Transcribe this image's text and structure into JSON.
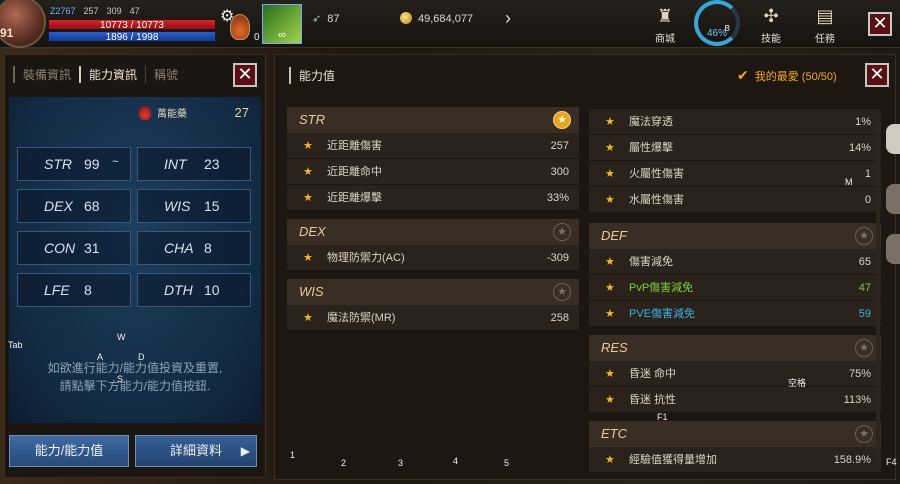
{
  "hud": {
    "level": "91",
    "stat1": "Z2767",
    "stat2": "257",
    "stat3": "309",
    "stat4": "47",
    "hp": "10773 / 10773",
    "mp": "1896 / 1998",
    "potion_count": "0",
    "buff_label": "∞",
    "currency1": "87",
    "gold": "49,684,077",
    "menus": [
      {
        "label": "商城",
        "icon": "bag-icon"
      },
      {
        "label": "46%",
        "key": "B"
      },
      {
        "label": "技能",
        "icon": "skill-icon"
      },
      {
        "label": "任務",
        "icon": "scroll-icon"
      }
    ],
    "close_label": "✕"
  },
  "left": {
    "tabs": [
      "裝備資訊",
      "能力資訊",
      "稱號"
    ],
    "active_tab": 1,
    "elixir_label": "萬能藥",
    "stat_points": "27",
    "stats": [
      {
        "key": "STR",
        "value": "99",
        "extra": "~"
      },
      {
        "key": "INT",
        "value": "23"
      },
      {
        "key": "DEX",
        "value": "68"
      },
      {
        "key": "WIS",
        "value": "15"
      },
      {
        "key": "CON",
        "value": "31"
      },
      {
        "key": "CHA",
        "value": "8"
      },
      {
        "key": "LFE",
        "value": "8"
      },
      {
        "key": "DTH",
        "value": "10"
      }
    ],
    "note_line1": "如欲進行能力/能力值投資及重置,",
    "note_line2": "請點擊下方能力/能力值按鈕.",
    "btn_ability": "能力/能力值",
    "btn_detail": "詳細資料"
  },
  "right": {
    "title": "能力值",
    "favorites": "我的最愛 (50/50)",
    "left_col": [
      {
        "section": "STR",
        "fav": true,
        "rows": [
          {
            "name": "近距離傷害",
            "value": "257"
          },
          {
            "name": "近距離命中",
            "value": "300"
          },
          {
            "name": "近距離爆擊",
            "value": "33%"
          }
        ]
      },
      {
        "section": "DEX",
        "fav": false,
        "rows": [
          {
            "name": "物理防禦力(AC)",
            "value": "-309"
          }
        ]
      },
      {
        "section": "WIS",
        "fav": false,
        "rows": [
          {
            "name": "魔法防禦(MR)",
            "value": "258"
          }
        ]
      }
    ],
    "right_col_top": [
      {
        "name": "魔法穿透",
        "value": "1%"
      },
      {
        "name": "屬性爆擊",
        "value": "14%"
      },
      {
        "name": "火屬性傷害",
        "value": "1"
      },
      {
        "name": "水屬性傷害",
        "value": "0"
      }
    ],
    "right_col": [
      {
        "section": "DEF",
        "fav": false,
        "rows": [
          {
            "name": "傷害減免",
            "value": "65",
            "tone": ""
          },
          {
            "name": "PvP傷害減免",
            "value": "47",
            "tone": "green"
          },
          {
            "name": "PVE傷害減免",
            "value": "59",
            "tone": "blue"
          }
        ]
      },
      {
        "section": "RES",
        "fav": false,
        "rows": [
          {
            "name": "昏迷 命中",
            "value": "75%",
            "tone": ""
          },
          {
            "name": "昏迷 抗性",
            "value": "113%",
            "tone": ""
          }
        ]
      },
      {
        "section": "ETC",
        "fav": false,
        "rows": [
          {
            "name": "經驗值獲得量增加",
            "value": "158.9%",
            "tone": ""
          }
        ]
      }
    ]
  },
  "key_hints": {
    "tab": "Tab",
    "w": "W",
    "a": "A",
    "s": "S",
    "d": "D",
    "m": "M",
    "space": "空格",
    "f1": "F1",
    "f4": "F4",
    "n1": "1",
    "n2": "2",
    "n3": "3",
    "n4": "4",
    "n5": "5"
  },
  "colors": {
    "accent": "#e6a51e",
    "pvp": "#7ccf3b",
    "pve": "#3cb0e8",
    "button": "#3e6aa3"
  }
}
